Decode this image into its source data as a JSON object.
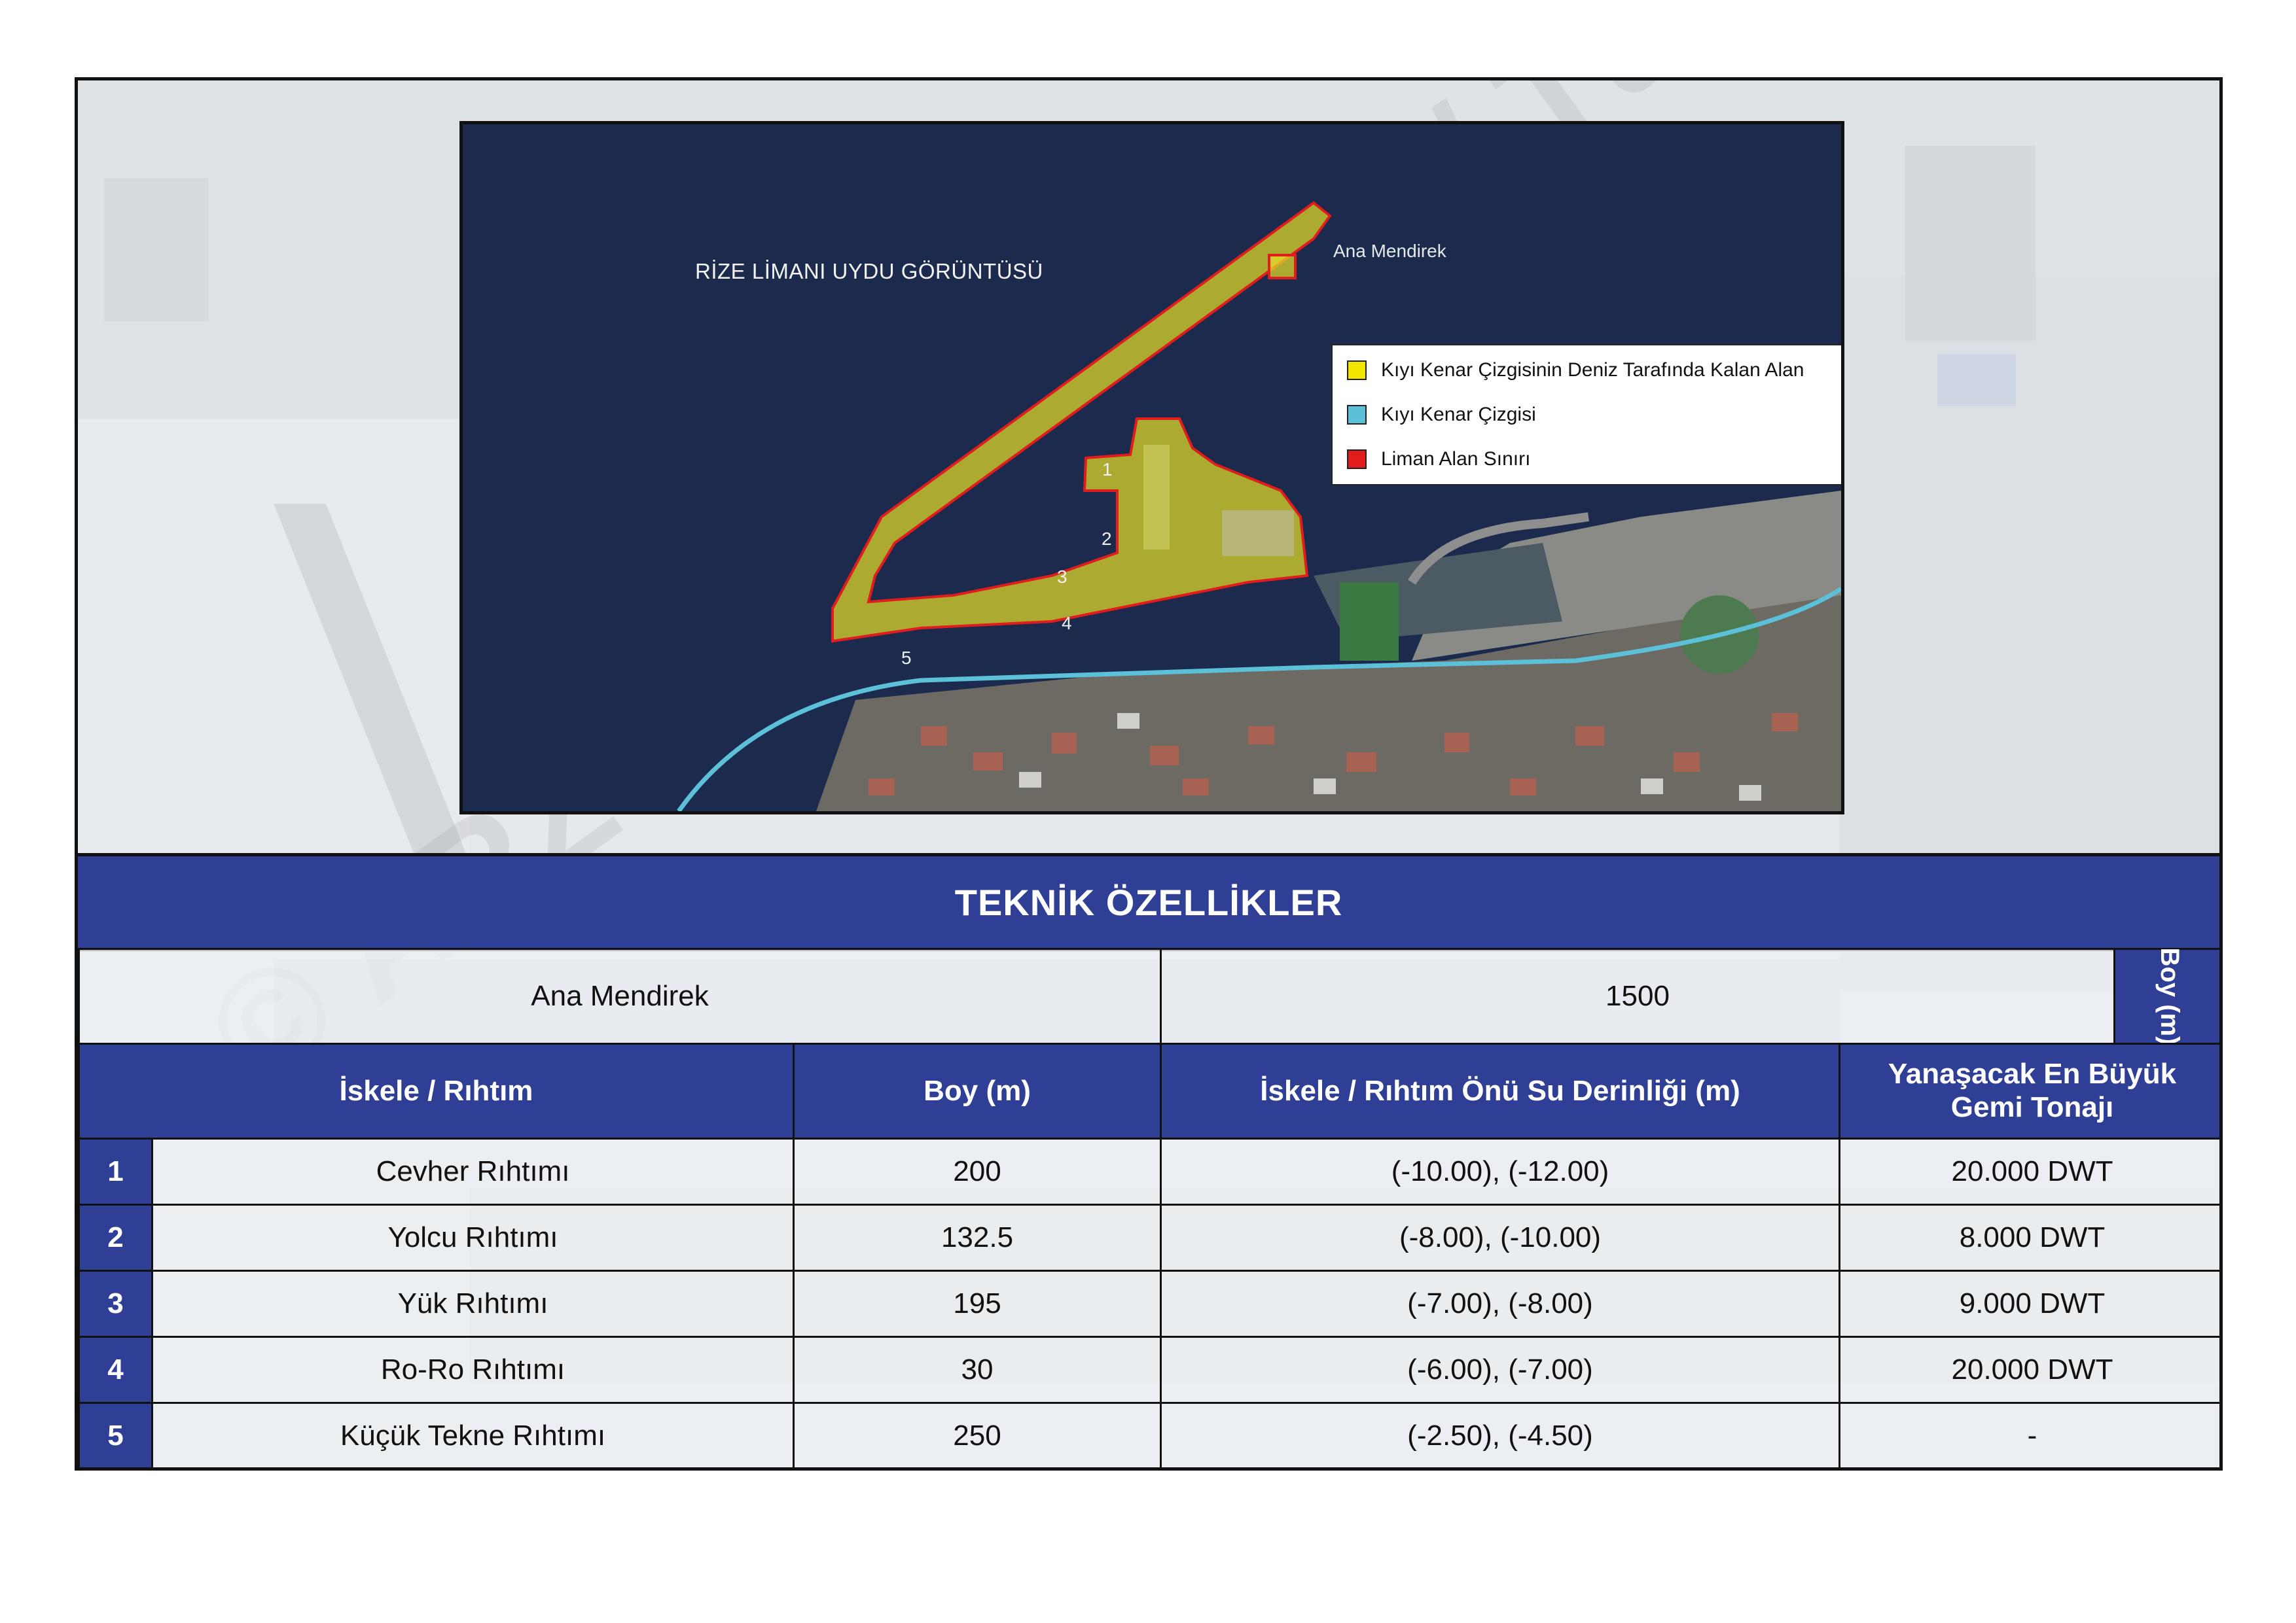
{
  "map": {
    "title": "RİZE LİMANI UYDU GÖRÜNTÜSÜ",
    "breakwater_label": "Ana Mendirek",
    "berth_numbers": [
      "1",
      "2",
      "3",
      "4",
      "5"
    ],
    "legend": [
      {
        "label": "Kıyı Kenar Çizgisinin Deniz Tarafında Kalan Alan",
        "color": "#f2e600"
      },
      {
        "label": "Kıyı Kenar Çizgisi",
        "color": "#5bc0d8"
      },
      {
        "label": "Liman Alan Sınırı",
        "color": "#e01c1c"
      }
    ]
  },
  "section_title": "TEKNİK ÖZELLİKLER",
  "main_breakwater": {
    "name": "Ana Mendirek",
    "length": "1500",
    "unit_label": "Boy (m)"
  },
  "table": {
    "headers": [
      "İskele / Rıhtım",
      "Boy (m)",
      "İskele / Rıhtım Önü Su Derinliği (m)",
      "Yanaşacak En Büyük Gemi Tonajı"
    ],
    "rows": [
      {
        "no": "1",
        "name": "Cevher Rıhtımı",
        "length": "200",
        "depth": "(-10.00), (-12.00)",
        "tonnage": "20.000 DWT"
      },
      {
        "no": "2",
        "name": "Yolcu Rıhtımı",
        "length": "132.5",
        "depth": "(-8.00), (-10.00)",
        "tonnage": "8.000 DWT"
      },
      {
        "no": "3",
        "name": "Yük Rıhtımı",
        "length": "195",
        "depth": "(-7.00), (-8.00)",
        "tonnage": "9.000 DWT"
      },
      {
        "no": "4",
        "name": "Ro-Ro Rıhtımı",
        "length": "30",
        "depth": "(-6.00), (-7.00)",
        "tonnage": "20.000 DWT"
      },
      {
        "no": "5",
        "name": "Küçük Tekne Rıhtımı",
        "length": "250",
        "depth": "(-2.50), (-4.50)",
        "tonnage": "-"
      }
    ]
  },
  "watermark": "© ARZ GLOBAL 2024/ Tüm Hakları Saklıdır."
}
